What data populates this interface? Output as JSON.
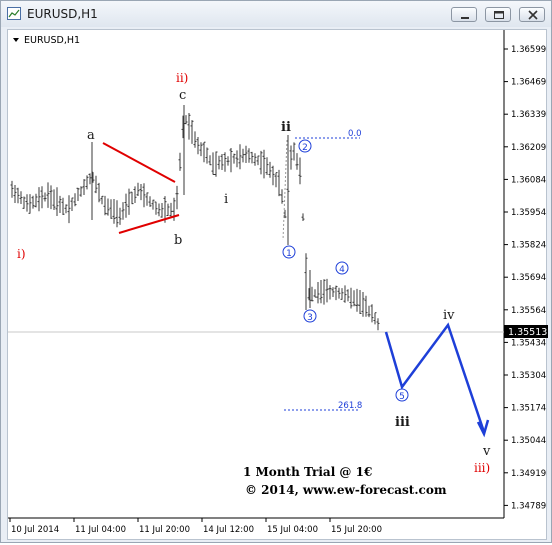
{
  "window": {
    "title": "EURUSD,H1"
  },
  "chart": {
    "symbol_label": "EURUSD,H1",
    "current_price": "1.35513",
    "y_ticks": [
      "1.36599",
      "1.36469",
      "1.36339",
      "1.36209",
      "1.36084",
      "1.35954",
      "1.35824",
      "1.35694",
      "1.35564",
      "1.35434",
      "1.35304",
      "1.35174",
      "1.35044",
      "1.34919",
      "1.34789"
    ],
    "x_ticks": [
      "10 Jul 2014",
      "11 Jul 04:00",
      "11 Jul 20:00",
      "14 Jul 12:00",
      "15 Jul 04:00",
      "15 Jul 20:00"
    ],
    "fib_top": "0.0",
    "fib_bottom": "261.8",
    "waves": {
      "i_red": "i)",
      "ii_red": "ii)",
      "iii_red": "iii)",
      "a": "a",
      "b": "b",
      "c": "c",
      "i": "i",
      "ii": "ii",
      "iii": "iii",
      "iv": "iv",
      "v": "v",
      "c1": "1",
      "c2": "2",
      "c3": "3",
      "c4": "4",
      "c5": "5"
    },
    "promo_line1": "1 Month Trial @ 1€",
    "promo_line2": "© 2014, www.ew-forecast.com"
  },
  "colors": {
    "red": "#e00000",
    "blue": "#1e3fd8",
    "bars": "#3a3a3a",
    "dark": "#1a1a1a"
  }
}
